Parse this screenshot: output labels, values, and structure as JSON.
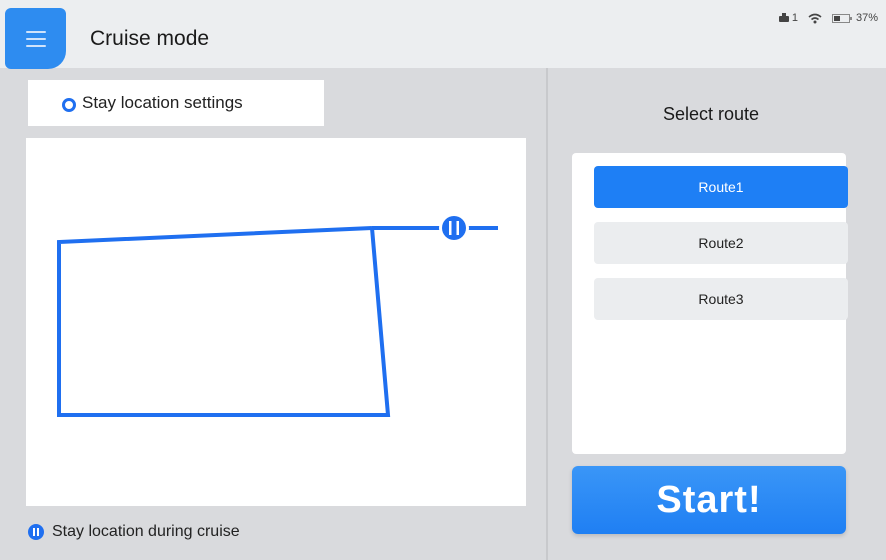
{
  "header": {
    "title": "Cruise mode",
    "status": {
      "robot_count": "1",
      "battery": "37%"
    }
  },
  "settings": {
    "label": "Stay location settings"
  },
  "route_panel": {
    "title": "Select route",
    "routes": [
      {
        "label": "Route1",
        "selected": true
      },
      {
        "label": "Route2",
        "selected": false
      },
      {
        "label": "Route3",
        "selected": false
      }
    ]
  },
  "start": {
    "label": "Start!"
  },
  "legend": {
    "label": "Stay location during cruise"
  },
  "colors": {
    "accent": "#1e7ff5",
    "route_line": "#1f6ff0"
  }
}
